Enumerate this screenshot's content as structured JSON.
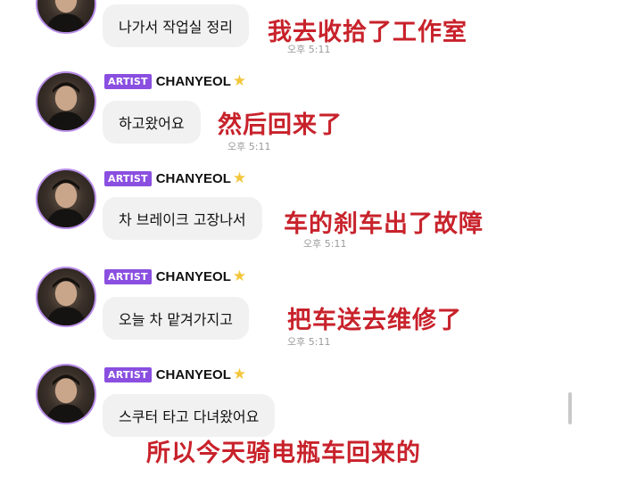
{
  "colors": {
    "badge_bg": "#8a4fe0",
    "overlay_text": "#c8222b",
    "bubble_bg": "#f1f1f2",
    "avatar_ring": "#b98ee8"
  },
  "messages": [
    {
      "badge": "",
      "name": "",
      "text": "나가서 작업실 정리",
      "time": "오후 5:11",
      "translation": "我去收拾了工作室"
    },
    {
      "badge": "ARTIST",
      "name": "CHANYEOL",
      "text": "하고왔어요",
      "time": "오후 5:11",
      "translation": "然后回来了"
    },
    {
      "badge": "ARTIST",
      "name": "CHANYEOL",
      "text": "차 브레이크 고장나서",
      "time": "오후 5:11",
      "translation": "车的刹车出了故障"
    },
    {
      "badge": "ARTIST",
      "name": "CHANYEOL",
      "text": "오늘 차 맡겨가지고",
      "time": "오후 5:11",
      "translation": "把车送去维修了"
    },
    {
      "badge": "ARTIST",
      "name": "CHANYEOL",
      "text": "스쿠터 타고 다녀왔어요",
      "time": "",
      "translation": "所以今天骑电瓶车回来的"
    }
  ]
}
